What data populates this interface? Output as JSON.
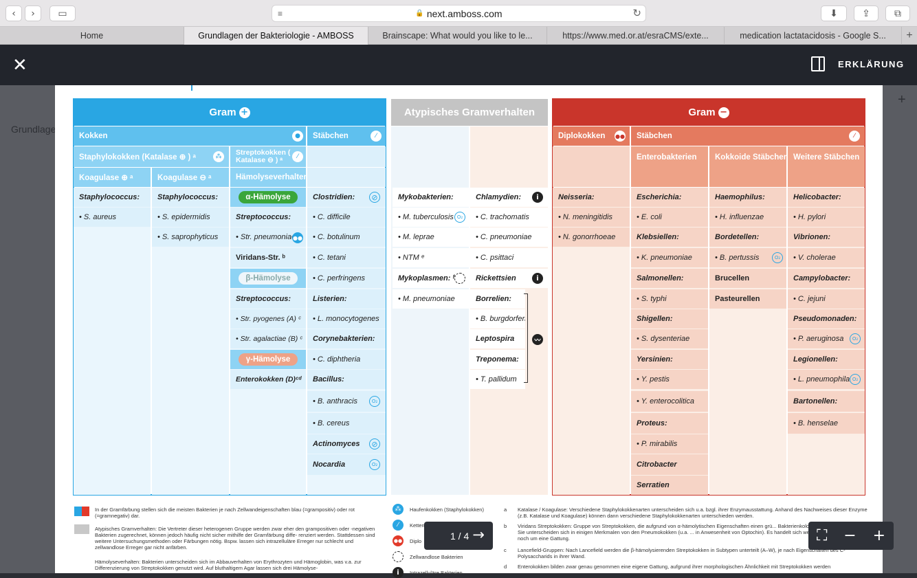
{
  "browser": {
    "url": "next.amboss.com",
    "tabs": [
      "Home",
      "Grundlagen der Bakteriologie - AMBOSS",
      "Brainscape: What would you like to le...",
      "https://www.med.or.at/esraCMS/exte...",
      "medication lactatacidosis - Google S..."
    ],
    "new_tab": "+"
  },
  "app": {
    "close": "✕",
    "erklaerung": "ERKLÄRUNG",
    "bg_title": "Grundlage",
    "bg_plus": "+"
  },
  "gram_pos": {
    "title": "Gram",
    "sign": "+",
    "kokken": "Kokken",
    "staebchen": "Stäbchen",
    "staph_head": "Staphylokokken (Katalase ⊕ ) ᵃ",
    "strep_head": "Streptokokken ( Katalase ⊖ ) ᵃ",
    "koag_pos": "Koagulase ⊕ ᵃ",
    "koag_neg": "Koagulase ⊖ ᵃ",
    "haemolyse": "Hämolyseverhalten",
    "col1": [
      "Staphylococcus:",
      "• S. aureus"
    ],
    "col2": [
      "Staphylococcus:",
      "• S. epidermidis",
      "• S. saprophyticus"
    ],
    "alpha": "α-Hämolyse",
    "beta": "β-Hämolyse",
    "gamma": "γ-Hämolyse",
    "alpha_items": [
      "Streptococcus:",
      "• Str. pneumoniae",
      "Viridans-Str. ᵇ"
    ],
    "beta_items": [
      "Streptococcus:",
      "• Str. pyogenes (A) ᶜ",
      "• Str. agalactiae (B) ᶜ"
    ],
    "gamma_items": [
      "Enterokokken (D)ᶜᵈ"
    ],
    "rods": [
      "Clostridien:",
      "• C. difficile",
      "• C. botulinum",
      "• C. tetani",
      "• C. perfringens",
      "Listerien:",
      "• L. monocytogenes",
      "Corynebakterien:",
      "• C. diphtheria",
      "Bacillus:",
      "• B. anthracis",
      "• B. cereus",
      "Actinomyces",
      "Nocardia"
    ]
  },
  "atyp": {
    "title": "Atypisches Gramverhalten",
    "left": [
      "Mykobakterien:",
      "• M. tuberculosis",
      "• M. leprae",
      "• NTM ᵉ",
      "Mykoplasmen: ᶠ",
      "• M. pneumoniae"
    ],
    "right": [
      "Chlamydien:",
      "• C. trachomatis",
      "• C. pneumoniae",
      "• C. psittaci",
      "Rickettsien",
      "Borrelien:",
      "• B. burgdorferi",
      "Leptospira",
      "Treponema:",
      "• T. pallidum"
    ]
  },
  "gram_neg": {
    "title": "Gram",
    "sign": "−",
    "diplo": "Diplokokken",
    "staebchen": "Stäbchen",
    "entero": "Enterobakterien",
    "kokkoid": "Kokkoide Stäbchen",
    "weitere": "Weitere Stäbchen",
    "neisseria": [
      "Neisseria:",
      "• N. meningitidis",
      "• N. gonorrhoeae"
    ],
    "entero_items": [
      "Escherichia:",
      "• E. coli",
      "Klebsiellen:",
      "• K. pneumoniae",
      "Salmonellen:",
      "• S. typhi",
      "Shigellen:",
      "• S. dysenteriae",
      "Yersinien:",
      "• Y. pestis",
      "• Y. enterocolitica",
      "Proteus:",
      "• P. mirabilis",
      "Citrobacter",
      "Serratien"
    ],
    "kokkoid_items": [
      "Haemophilus:",
      "• H. influenzae",
      "Bordetellen:",
      "• B. pertussis",
      "Brucellen",
      "Pasteurellen"
    ],
    "weitere_items": [
      "Helicobacter:",
      "• H. pylori",
      "Vibrionen:",
      "• V. cholerae",
      "Campylobacter:",
      "• C. jejuni",
      "Pseudomonaden:",
      "• P. aeruginosa",
      "Legionellen:",
      "• L. pneumophila",
      "Bartonellen:",
      "• B. henselae"
    ]
  },
  "legend": {
    "gram_text": "In der Gramfärbung stellen sich die meisten Bakterien je nach Zellwandeigenschaften blau (=grampositiv) oder rot (=gramnegativ) dar.",
    "atyp_text": "Atypisches Gramverhalten: Die Vertreter dieser heterogenen Gruppe werden zwar eher den grampositiven oder -negativen Bakterien zugerechnet, können jedoch häufig nicht sicher mithilfe der Gramfärbung diffe- renziert werden. Stattdessen sind weitere Untersuchungsmethoden oder Färbungen nötig. Bspw. lassen sich intrazelluläre Erreger nur schlecht und zellwandlose Erreger gar nicht anfärben.",
    "haem_text": "Hämolyseverhalten: Bakterien unterscheiden sich im Abbauverhalten von Erythrozyten und Hämoglobin, was v.a. zur Differenzierung von Streptokokken genutzt wird. Auf bluthaltigem Agar lassen sich drei Hämolyse-",
    "icons": [
      "Haufenkokken (Staphylokokken)",
      "Ketten",
      "Diplo",
      "Zellwandlose Bakterien",
      "Intrazelluläre Bakterien"
    ],
    "notes": [
      {
        "k": "a",
        "t": "Katalase / Koagulase: Verschiedene Staphylokokkenarten unterscheiden sich u.a. bzgl. ihrer Enzymausstattung. Anhand des Nachweises dieser Enzyme (z.B. Katalase und Koagulase) können dann verschiedene Staphylokokkenarten unterschieden werden."
      },
      {
        "k": "b",
        "t": "Viridans Streptokokken: Gruppe von Streptokokken, die aufgrund von α-hämolytischen Eigenschaften einen grü... Bakterienkolonie auf dem Agar bilden. Sie unterscheiden sich in einigen Merkmalen von den Pneumokokken (u.a. ... in Anwesenheit von Optochin). Es handelt sich weder um eine eigene Art noch um eine Gattung."
      },
      {
        "k": "c",
        "t": "Lancefield-Gruppen: Nach Lancefield werden die β-hämolysierenden Streptokokken in Subtypen unterteilt (A–W), je nach Eigenschaften des C-Polysaccharids in ihrer Wand."
      },
      {
        "k": "d",
        "t": "Enterokokken bilden zwar genau genommen eine eigene Gattung, aufgrund ihrer morphologischen Ähnlichkeit mit Streptokokken werden"
      }
    ]
  },
  "pager": {
    "label": "1 / 4"
  },
  "colors": {
    "blue": "#29a6e3",
    "red": "#c9352b",
    "grey": "#c4c4c4",
    "alpha": "#3aa63a",
    "gamma": "#eea287"
  }
}
